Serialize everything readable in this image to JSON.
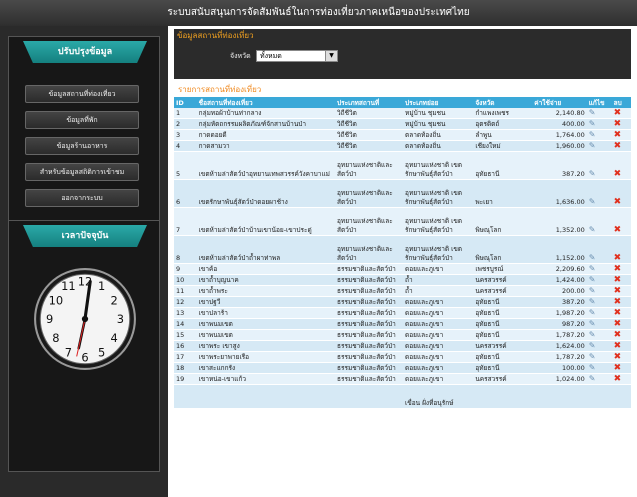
{
  "app_title": "ระบบสนับสนุนการจัดสัมพันธ์ในการท่องเที่ยวภาคเหนือของประเทศไทย",
  "sidebar": {
    "menu_title": "ปรับปรุงข้อมูล",
    "items": [
      {
        "label": "ข้อมูลสถานที่ท่องเที่ยว"
      },
      {
        "label": "ข้อมูลที่พัก"
      },
      {
        "label": "ข้อมูลร้านอาหาร"
      },
      {
        "label": "สำหรับข้อมูลสถิติการเข้าชม"
      },
      {
        "label": "ออกจากระบบ"
      }
    ],
    "clock_title": "เวลาปัจจุบัน"
  },
  "main": {
    "section_title": "ข้อมูลสถานที่ท่องเที่ยว",
    "filter_label": "จังหวัด",
    "filter_value": "ทั้งหมด",
    "list_title": "รายการสถานที่ท่องเที่ยว",
    "columns": [
      "ID",
      "ชื่อสถานที่ท่องเที่ยว",
      "ประเภทสถานที่",
      "ประเภทย่อย",
      "จังหวัด",
      "ค่าใช้จ่าย",
      "แก้ไข",
      "ลบ"
    ],
    "rows": [
      {
        "id": "1",
        "name": "กลุ่มทอผ้าบ้านท่ากลาง",
        "type": "วิถีชีวิต",
        "subtype": "หมู่บ้าน ชุมชน",
        "province": "กำแพงเพชร",
        "cost": "2,140.80"
      },
      {
        "id": "2",
        "name": "กลุ่มหัตถกรรมผลิตภัณฑ์จักสานบ้านป่า",
        "type": "วิถีชีวิต",
        "subtype": "หมู่บ้าน ชุมชน",
        "province": "อุตรดิตถ์",
        "cost": "400.00"
      },
      {
        "id": "3",
        "name": "กาดดอยดี",
        "type": "วิถีชีวิต",
        "subtype": "ตลาดท้องถิ่น",
        "province": "ลำพูน",
        "cost": "1,764.00"
      },
      {
        "id": "4",
        "name": "กาดสามวา",
        "type": "วิถีชีวิต",
        "subtype": "ตลาดท้องถิ่น",
        "province": "เชียงใหม่",
        "cost": "1,960.00"
      },
      {
        "id": "5",
        "name": "เขตห้ามล่าสัตว์ป่าอุทยานเทพสวรรค์วังคาบาแม่",
        "type": "อุทยานแห่งชาติและสัตว์ป่า",
        "subtype": "อุทยานแห่งชาติ เขตรักษาพันธุ์สัตว์ป่า",
        "province": "อุทัยธานี",
        "cost": "387.20"
      },
      {
        "id": "6",
        "name": "เขตรักษาพันธุ์สัตว์ป่าดอยผาช้าง",
        "type": "อุทยานแห่งชาติและสัตว์ป่า",
        "subtype": "อุทยานแห่งชาติ เขตรักษาพันธุ์สัตว์ป่า",
        "province": "พะเยา",
        "cost": "1,636.00"
      },
      {
        "id": "7",
        "name": "เขตห้ามล่าสัตว์ป่าบ้านเขาน้อย-เขาประดู่",
        "type": "อุทยานแห่งชาติและสัตว์ป่า",
        "subtype": "อุทยานแห่งชาติ เขตรักษาพันธุ์สัตว์ป่า",
        "province": "พิษณุโลก",
        "cost": "1,352.00"
      },
      {
        "id": "8",
        "name": "เขตห้ามล่าสัตว์ป่าถ้ำผาท่าพล",
        "type": "อุทยานแห่งชาติและสัตว์ป่า",
        "subtype": "อุทยานแห่งชาติ เขตรักษาพันธุ์สัตว์ป่า",
        "province": "พิษณุโลก",
        "cost": "1,152.00"
      },
      {
        "id": "9",
        "name": "เขาค้อ",
        "type": "ธรรมชาติและสัตว์ป่า",
        "subtype": "ดอยและภูเขา",
        "province": "เพชรบูรณ์",
        "cost": "2,209.60"
      },
      {
        "id": "10",
        "name": "เขาถ้ำบุญนาค",
        "type": "ธรรมชาติและสัตว์ป่า",
        "subtype": "ถ้ำ",
        "province": "นครสวรรค์",
        "cost": "1,424.00"
      },
      {
        "id": "11",
        "name": "เขาถ้ำพระ",
        "type": "ธรรมชาติและสัตว์ป่า",
        "subtype": "ถ้ำ",
        "province": "นครสวรรค์",
        "cost": "200.00"
      },
      {
        "id": "12",
        "name": "เขาปฐวี",
        "type": "ธรรมชาติและสัตว์ป่า",
        "subtype": "ดอยและภูเขา",
        "province": "อุทัยธานี",
        "cost": "387.20"
      },
      {
        "id": "13",
        "name": "เขาปลาร้า",
        "type": "ธรรมชาติและสัตว์ป่า",
        "subtype": "ดอยและภูเขา",
        "province": "อุทัยธานี",
        "cost": "1,987.20"
      },
      {
        "id": "14",
        "name": "เขาพนมเขต",
        "type": "ธรรมชาติและสัตว์ป่า",
        "subtype": "ดอยและภูเขา",
        "province": "อุทัยธานี",
        "cost": "987.20"
      },
      {
        "id": "15",
        "name": "เขาพนมเขต",
        "type": "ธรรมชาติและสัตว์ป่า",
        "subtype": "ดอยและภูเขา",
        "province": "อุทัยธานี",
        "cost": "1,787.20"
      },
      {
        "id": "16",
        "name": "เขาพระ เขาสูง",
        "type": "ธรรมชาติและสัตว์ป่า",
        "subtype": "ดอยและภูเขา",
        "province": "นครสวรรค์",
        "cost": "1,624.00"
      },
      {
        "id": "17",
        "name": "เขาพระยาพายเรือ",
        "type": "ธรรมชาติและสัตว์ป่า",
        "subtype": "ดอยและภูเขา",
        "province": "อุทัยธานี",
        "cost": "1,787.20"
      },
      {
        "id": "18",
        "name": "เขาสะแกกรัง",
        "type": "ธรรมชาติและสัตว์ป่า",
        "subtype": "ดอยและภูเขา",
        "province": "อุทัยธานี",
        "cost": "100.00"
      },
      {
        "id": "19",
        "name": "เขาหน่อ-เขาแก้ว",
        "type": "ธรรมชาติและสัตว์ป่า",
        "subtype": "ดอยและภูเขา",
        "province": "นครสวรรค์",
        "cost": "1,024.00"
      },
      {
        "id": "",
        "name": "",
        "type": "",
        "subtype": "เขื่อน ฝั่งที่อนุรักษ์",
        "province": "",
        "cost": ""
      }
    ],
    "edit_icon": "edit-icon",
    "delete_icon": "delete-icon"
  },
  "colors": {
    "header_bg": "#2e2e2e",
    "ribbon": "#1c9796",
    "table_header": "#3aa8d8",
    "accent_orange": "#f08a20",
    "delete_red": "#e0301e"
  }
}
